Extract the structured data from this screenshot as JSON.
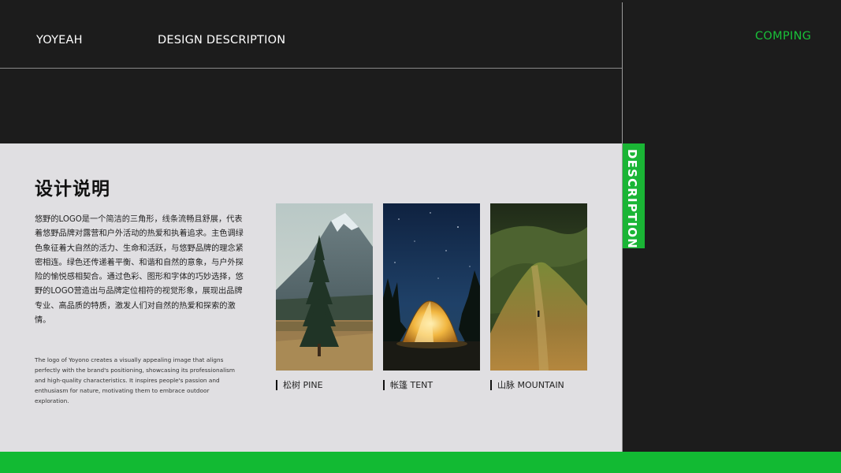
{
  "header": {
    "brand": "YOYEAH",
    "section": "DESIGN DESCRIPTION",
    "side_label": "COMPING"
  },
  "tab": {
    "label": "DESCRIPTION"
  },
  "main": {
    "title": "设计说明",
    "body_cn": "悠野的LOGO是一个简洁的三角形，线条流畅且舒展，代表着悠野品牌对露营和户外活动的热爱和执着追求。主色调绿色象征着大自然的活力、生命和活跃，与悠野品牌的理念紧密相连。绿色还传递着平衡、和谐和自然的意象，与户外探险的愉悦感相契合。通过色彩、图形和字体的巧妙选择，悠野的LOGO营造出与品牌定位相符的视觉形象，展现出品牌专业、高品质的特质，激发人们对自然的热爱和探索的激情。",
    "body_en": "The logo of Yoyono creates a visually appealing image that aligns perfectly with the brand's positioning, showcasing its professionalism and high-quality characteristics. It inspires people's passion and enthusiasm for nature, motivating them to embrace outdoor exploration."
  },
  "gallery": [
    {
      "icon": "pine-tree-photo",
      "caption": "松树  PINE"
    },
    {
      "icon": "tent-photo",
      "caption": "帐篷  TENT"
    },
    {
      "icon": "mountain-photo",
      "caption": "山脉  MOUNTAIN"
    }
  ],
  "colors": {
    "accent": "#19c039",
    "background": "#1c1c1c",
    "panel": "#e0dfe2"
  }
}
